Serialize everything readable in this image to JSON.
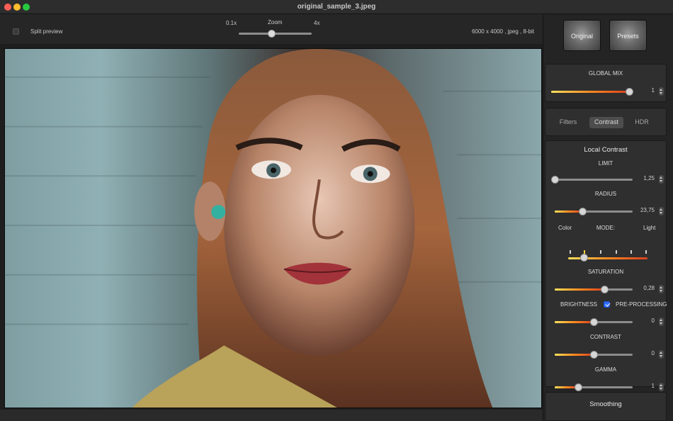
{
  "window": {
    "title": "original_sample_3.jpeg"
  },
  "toolbar": {
    "split_preview_label": "Split preview",
    "zoom_label": "Zoom",
    "zoom_min_label": "0.1x",
    "zoom_max_label": "4x",
    "zoom_level": 0.45,
    "image_info": "6000 x 4000 , jpeg , 8-bit"
  },
  "panel": {
    "original_button": "Original",
    "presets_button": "Presets",
    "global_mix": {
      "label": "GLOBAL MIX",
      "value": "1",
      "level": 1.0
    },
    "tabs": [
      {
        "label": "Filters",
        "active": false
      },
      {
        "label": "Contrast",
        "active": true
      },
      {
        "label": "HDR",
        "active": false
      }
    ],
    "local_contrast": {
      "title": "Local Contrast",
      "limit": {
        "label": "LIMIT",
        "value": "1,25",
        "level": 0.0
      },
      "radius": {
        "label": "RADIUS",
        "value": "23,75",
        "level": 0.35
      },
      "mode": {
        "label": "MODE:",
        "left_label": "Color",
        "right_label": "Light",
        "level": 0.2
      },
      "saturation": {
        "label": "SATURATION",
        "value": "0,28",
        "level": 0.64
      },
      "brightness": {
        "label": "BRIGHTNESS",
        "value": "0",
        "level": 0.5
      },
      "preprocessing": {
        "label": "PRE-PROCESSING",
        "checked": true
      },
      "contrast": {
        "label": "CONTRAST",
        "value": "0",
        "level": 0.5
      },
      "gamma": {
        "label": "GAMMA",
        "value": "1",
        "level": 0.3
      }
    },
    "smoothing": {
      "title": "Smoothing"
    }
  },
  "colors": {
    "accent_start": "#ffe15a",
    "accent_mid": "#ff8a1f",
    "accent_end": "#d8401f",
    "checkbox": "#2f6bff"
  }
}
